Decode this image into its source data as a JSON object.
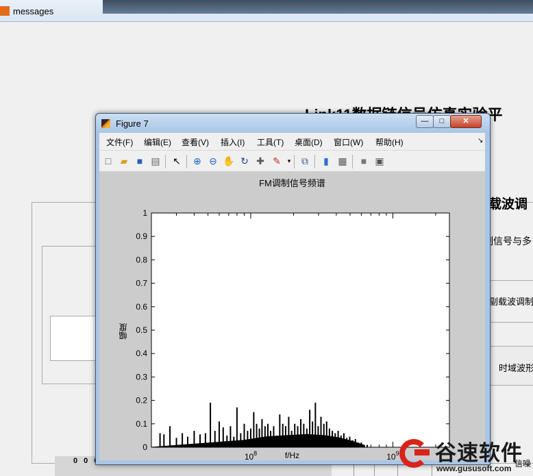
{
  "background_window": {
    "title": "messages",
    "heading": "Link11数据链信号仿真实验平",
    "subheading": "载波调",
    "sub_text1": "制信号与多",
    "button_label1": "副载波调制",
    "button_label2": "时域波形",
    "bottom_digits": "0 0 0",
    "bottom_right_text": "信噪"
  },
  "figure_window": {
    "title": "Figure 7",
    "controls": {
      "minimize": "—",
      "maximize": "□",
      "close": "✕"
    },
    "menu": [
      "文件(F)",
      "编辑(E)",
      "查看(V)",
      "插入(I)",
      "工具(T)",
      "桌面(D)",
      "窗口(W)",
      "帮助(H)"
    ],
    "toolbar_icons": [
      "new-figure-icon",
      "open-icon",
      "save-icon",
      "print-icon",
      "pointer-icon",
      "zoom-in-icon",
      "zoom-out-icon",
      "pan-icon",
      "rotate-icon",
      "data-cursor-icon",
      "brush-icon",
      "link-icon",
      "colorbar-icon",
      "legend-icon",
      "hide-plot-tools-icon",
      "show-plot-tools-icon"
    ]
  },
  "chart_data": {
    "type": "bar",
    "title": "FM调制信号频谱",
    "xlabel": "f/Hz",
    "ylabel": "幅度",
    "xscale": "log",
    "xlim": [
      20000000,
      2500000000
    ],
    "ylim": [
      0,
      1
    ],
    "x_tick_labels": [
      "10^8",
      "10^9"
    ],
    "y_ticks": [
      0,
      0.1,
      0.2,
      0.3,
      0.4,
      0.5,
      0.6,
      0.7,
      0.8,
      0.9,
      1
    ],
    "grid": false,
    "spikes": [
      {
        "f": 23000000,
        "a": 0.06
      },
      {
        "f": 24500000,
        "a": 0.055
      },
      {
        "f": 27000000,
        "a": 0.09
      },
      {
        "f": 30000000,
        "a": 0.04
      },
      {
        "f": 33000000,
        "a": 0.06
      },
      {
        "f": 36000000,
        "a": 0.045
      },
      {
        "f": 40000000,
        "a": 0.07
      },
      {
        "f": 44000000,
        "a": 0.055
      },
      {
        "f": 48000000,
        "a": 0.06
      },
      {
        "f": 52000000,
        "a": 0.19
      },
      {
        "f": 56000000,
        "a": 0.07
      },
      {
        "f": 60000000,
        "a": 0.11
      },
      {
        "f": 64000000,
        "a": 0.085
      },
      {
        "f": 68000000,
        "a": 0.05
      },
      {
        "f": 72000000,
        "a": 0.09
      },
      {
        "f": 76000000,
        "a": 0.045
      },
      {
        "f": 80000000,
        "a": 0.17
      },
      {
        "f": 85000000,
        "a": 0.06
      },
      {
        "f": 90000000,
        "a": 0.1
      },
      {
        "f": 95000000,
        "a": 0.07
      },
      {
        "f": 100000000,
        "a": 0.08
      },
      {
        "f": 105000000,
        "a": 0.15
      },
      {
        "f": 110000000,
        "a": 0.1
      },
      {
        "f": 115000000,
        "a": 0.08
      },
      {
        "f": 120000000,
        "a": 0.12
      },
      {
        "f": 126000000,
        "a": 0.09
      },
      {
        "f": 132000000,
        "a": 0.1
      },
      {
        "f": 138000000,
        "a": 0.07
      },
      {
        "f": 145000000,
        "a": 0.09
      },
      {
        "f": 152000000,
        "a": 0.05
      },
      {
        "f": 160000000,
        "a": 0.14
      },
      {
        "f": 168000000,
        "a": 0.1
      },
      {
        "f": 176000000,
        "a": 0.09
      },
      {
        "f": 185000000,
        "a": 0.13
      },
      {
        "f": 194000000,
        "a": 0.07
      },
      {
        "f": 204000000,
        "a": 0.1
      },
      {
        "f": 214000000,
        "a": 0.09
      },
      {
        "f": 225000000,
        "a": 0.12
      },
      {
        "f": 236000000,
        "a": 0.1
      },
      {
        "f": 248000000,
        "a": 0.08
      },
      {
        "f": 260000000,
        "a": 0.16
      },
      {
        "f": 272000000,
        "a": 0.11
      },
      {
        "f": 285000000,
        "a": 0.19
      },
      {
        "f": 298000000,
        "a": 0.09
      },
      {
        "f": 312000000,
        "a": 0.13
      },
      {
        "f": 327000000,
        "a": 0.1
      },
      {
        "f": 342000000,
        "a": 0.11
      },
      {
        "f": 358000000,
        "a": 0.08
      },
      {
        "f": 375000000,
        "a": 0.07
      },
      {
        "f": 393000000,
        "a": 0.06
      },
      {
        "f": 412000000,
        "a": 0.07
      },
      {
        "f": 432000000,
        "a": 0.05
      },
      {
        "f": 452000000,
        "a": 0.06
      },
      {
        "f": 474000000,
        "a": 0.04
      },
      {
        "f": 497000000,
        "a": 0.045
      },
      {
        "f": 520000000,
        "a": 0.03
      },
      {
        "f": 545000000,
        "a": 0.035
      },
      {
        "f": 572000000,
        "a": 0.02
      },
      {
        "f": 600000000,
        "a": 0.02
      },
      {
        "f": 630000000,
        "a": 0.01
      },
      {
        "f": 660000000,
        "a": 0.01
      }
    ],
    "noise_floor": [
      {
        "f": 90000000,
        "a": 0.03
      },
      {
        "f": 130000000,
        "a": 0.045
      },
      {
        "f": 180000000,
        "a": 0.05
      },
      {
        "f": 250000000,
        "a": 0.055
      },
      {
        "f": 330000000,
        "a": 0.05
      },
      {
        "f": 420000000,
        "a": 0.04
      },
      {
        "f": 520000000,
        "a": 0.025
      },
      {
        "f": 620000000,
        "a": 0.01
      }
    ]
  },
  "watermark": {
    "name": "谷速软件",
    "url": "www.gususoft.com"
  }
}
